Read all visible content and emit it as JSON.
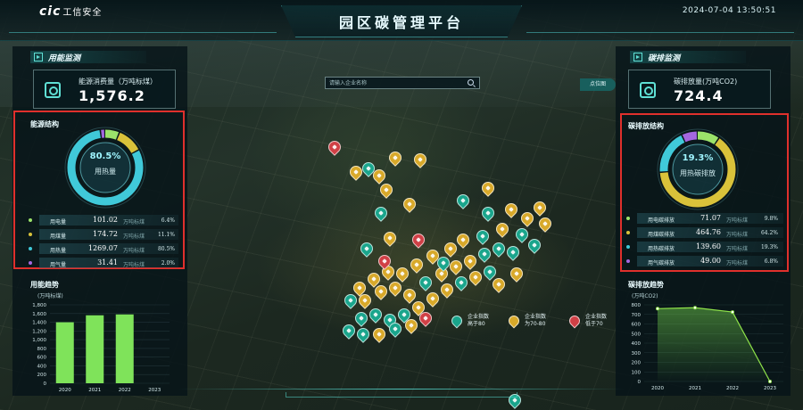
{
  "header": {
    "logo_text": "cic",
    "logo_cn": "工信安全",
    "title": "园区碳管理平台",
    "datetime": "2024-07-04 13:50:51"
  },
  "left": {
    "section_title": "用能监测",
    "kpi_label": "能源消费量（万吨标煤）",
    "kpi_value": "1,576.2",
    "structure_title": "能源结构",
    "donut_pct": "80.5%",
    "donut_label": "用热量",
    "rows": [
      {
        "name": "用电量",
        "value": "101.02",
        "unit": "万吨标煤",
        "pct": "6.4%",
        "color": "#9be36a"
      },
      {
        "name": "用煤量",
        "value": "174.72",
        "unit": "万吨标煤",
        "pct": "11.1%",
        "color": "#d9c23a"
      },
      {
        "name": "用热量",
        "value": "1269.07",
        "unit": "万吨标煤",
        "pct": "80.5%",
        "color": "#40c9d9"
      },
      {
        "name": "用气量",
        "value": "31.41",
        "unit": "万吨标煤",
        "pct": "2.0%",
        "color": "#a467e0"
      }
    ],
    "trend_title": "用能趋势",
    "trend_unit": "(万吨标煤)"
  },
  "right": {
    "section_title": "碳排监测",
    "kpi_label": "碳排放量(万吨CO2)",
    "kpi_value": "724.4",
    "structure_title": "碳排放结构",
    "donut_pct": "19.3%",
    "donut_label": "用热碳排放",
    "rows": [
      {
        "name": "用电碳排放",
        "value": "71.07",
        "unit": "万吨标煤",
        "pct": "9.8%",
        "color": "#9be36a"
      },
      {
        "name": "用煤碳排放",
        "value": "464.76",
        "unit": "万吨标煤",
        "pct": "64.2%",
        "color": "#d9c23a"
      },
      {
        "name": "用热碳排放",
        "value": "139.60",
        "unit": "万吨标煤",
        "pct": "19.3%",
        "color": "#40c9d9"
      },
      {
        "name": "用气碳排放",
        "value": "49.00",
        "unit": "万吨标煤",
        "pct": "6.8%",
        "color": "#a467e0"
      }
    ],
    "trend_title": "碳排放趋势",
    "trend_unit": "(万吨CO2)"
  },
  "map": {
    "search_placeholder": "请输入企业名称",
    "tag_label": "点位图",
    "legend": [
      {
        "line1": "企业指数",
        "line2": "高于80",
        "color": "#1aa58c"
      },
      {
        "line1": "企业指数",
        "line2": "为70-80",
        "color": "#d8a92a"
      },
      {
        "line1": "企业指数",
        "line2": "低于70",
        "color": "#d04046"
      }
    ]
  },
  "chart_data": [
    {
      "type": "bar",
      "title": "用能趋势",
      "ylabel": "(万吨标煤)",
      "categories": [
        "2020",
        "2021",
        "2022",
        "2023"
      ],
      "values": [
        1400,
        1560,
        1580,
        0
      ],
      "ylim": [
        0,
        1800
      ],
      "yticks": [
        0,
        200,
        400,
        600,
        800,
        1000,
        1200,
        1400,
        1600,
        1800
      ],
      "ytick_labels": [
        "0",
        "200",
        "400",
        "600",
        "800",
        "1,000",
        "1,200",
        "1,400",
        "1,600",
        "1,800"
      ],
      "color": "#7fe35a"
    },
    {
      "type": "area",
      "title": "碳排放趋势",
      "ylabel": "(万吨CO2)",
      "categories": [
        "2020",
        "2021",
        "2022",
        "2023"
      ],
      "values": [
        760,
        770,
        725,
        0
      ],
      "ylim": [
        0,
        800
      ],
      "yticks": [
        0,
        100,
        200,
        300,
        400,
        500,
        600,
        700,
        800
      ],
      "ytick_labels": [
        "0",
        "100",
        "200",
        "300",
        "400",
        "500",
        "600",
        "700",
        "800"
      ],
      "color": "#8fe34a"
    }
  ]
}
